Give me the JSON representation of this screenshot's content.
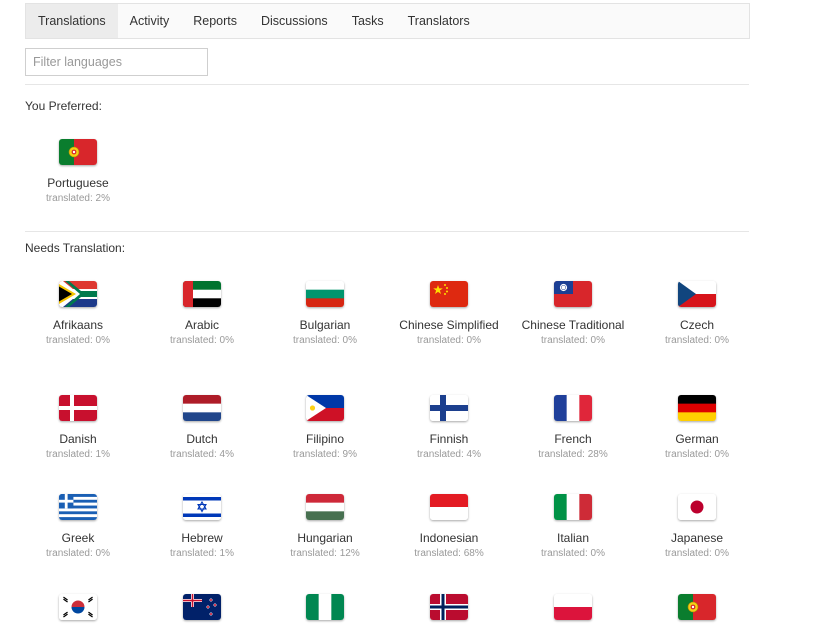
{
  "tabs": [
    {
      "label": "Translations",
      "active": true
    },
    {
      "label": "Activity"
    },
    {
      "label": "Reports"
    },
    {
      "label": "Discussions"
    },
    {
      "label": "Tasks"
    },
    {
      "label": "Translators"
    }
  ],
  "filter": {
    "placeholder": "Filter languages",
    "value": ""
  },
  "preferred": {
    "title": "You Preferred:",
    "languages": [
      {
        "name": "Portuguese",
        "status": "translated: 2%",
        "flag": "portugal-flag"
      }
    ]
  },
  "needs": {
    "title": "Needs Translation:",
    "languages": [
      {
        "name": "Afrikaans",
        "status": "translated: 0%",
        "flag": "south-africa-flag"
      },
      {
        "name": "Arabic",
        "status": "translated: 0%",
        "flag": "uae-flag"
      },
      {
        "name": "Bulgarian",
        "status": "translated: 0%",
        "flag": "bulgaria-flag"
      },
      {
        "name": "Chinese Simplified",
        "status": "translated: 0%",
        "flag": "china-flag"
      },
      {
        "name": "Chinese Traditional",
        "status": "translated: 0%",
        "flag": "taiwan-flag"
      },
      {
        "name": "Czech",
        "status": "translated: 0%",
        "flag": "czech-flag"
      },
      {
        "name": "Danish",
        "status": "translated: 1%",
        "flag": "denmark-flag"
      },
      {
        "name": "Dutch",
        "status": "translated: 4%",
        "flag": "netherlands-flag"
      },
      {
        "name": "Filipino",
        "status": "translated: 9%",
        "flag": "philippines-flag"
      },
      {
        "name": "Finnish",
        "status": "translated: 4%",
        "flag": "finland-flag"
      },
      {
        "name": "French",
        "status": "translated: 28%",
        "flag": "france-flag"
      },
      {
        "name": "German",
        "status": "translated: 0%",
        "flag": "germany-flag"
      },
      {
        "name": "Greek",
        "status": "translated: 0%",
        "flag": "greece-flag"
      },
      {
        "name": "Hebrew",
        "status": "translated: 1%",
        "flag": "israel-flag"
      },
      {
        "name": "Hungarian",
        "status": "translated: 12%",
        "flag": "hungary-flag"
      },
      {
        "name": "Indonesian",
        "status": "translated: 68%",
        "flag": "indonesia-flag"
      },
      {
        "name": "Italian",
        "status": "translated: 0%",
        "flag": "italy-flag"
      },
      {
        "name": "Japanese",
        "status": "translated: 0%",
        "flag": "japan-flag"
      },
      {
        "name": "",
        "status": "",
        "flag": "south-korea-flag"
      },
      {
        "name": "",
        "status": "",
        "flag": "new-zealand-flag"
      },
      {
        "name": "",
        "status": "",
        "flag": "nigeria-flag"
      },
      {
        "name": "",
        "status": "",
        "flag": "norway-flag"
      },
      {
        "name": "",
        "status": "",
        "flag": "poland-flag"
      },
      {
        "name": "",
        "status": "",
        "flag": "portugal-flag"
      }
    ]
  }
}
